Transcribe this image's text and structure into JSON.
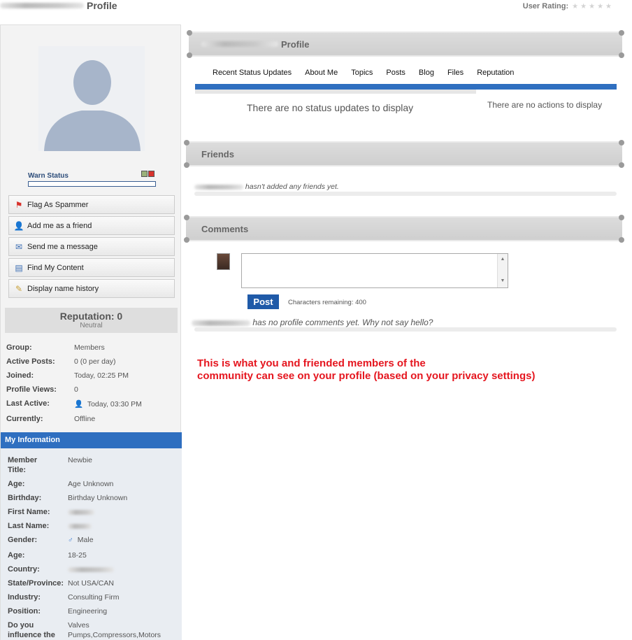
{
  "header": {
    "title": "Profile",
    "user_rating_label": "User Rating:"
  },
  "sidebar": {
    "warn_status": "Warn Status",
    "actions": [
      {
        "label": "Flag As Spammer",
        "icon": "flag-icon"
      },
      {
        "label": "Add me as a friend",
        "icon": "add-friend-icon"
      },
      {
        "label": "Send me a message",
        "icon": "envelope-icon"
      },
      {
        "label": "Find My Content",
        "icon": "document-icon"
      },
      {
        "label": "Display name history",
        "icon": "tag-icon"
      }
    ],
    "reputation": {
      "title": "Reputation: 0",
      "subtitle": "Neutral"
    },
    "stats": [
      {
        "label": "Group:",
        "value": "Members"
      },
      {
        "label": "Active Posts:",
        "value": "0 (0 per day)"
      },
      {
        "label": "Joined:",
        "value": "Today, 02:25 PM"
      },
      {
        "label": "Profile Views:",
        "value": "0"
      },
      {
        "label": "Last Active:",
        "value": "Today, 03:30 PM"
      },
      {
        "label": "Currently:",
        "value": "Offline"
      }
    ],
    "my_info_title": "My Information",
    "my_info": [
      {
        "label": "Member Title:",
        "value": "Newbie"
      },
      {
        "label": "Age:",
        "value": "Age Unknown"
      },
      {
        "label": "Birthday:",
        "value": "Birthday Unknown"
      },
      {
        "label": "First Name:",
        "value": ""
      },
      {
        "label": "Last Name:",
        "value": ""
      },
      {
        "label": "Gender:",
        "value": "Male"
      },
      {
        "label": "Age:",
        "value": "18-25"
      },
      {
        "label": "Country:",
        "value": ""
      },
      {
        "label": "State/Province:",
        "value": "Not USA/CAN"
      },
      {
        "label": "Industry:",
        "value": "Consulting Firm"
      },
      {
        "label": "Position:",
        "value": "Engineering"
      },
      {
        "label": "Do you influence the",
        "value": "Valves Pumps,Compressors,Motors"
      }
    ]
  },
  "profile_panel": {
    "title": "Profile",
    "tabs": [
      "Recent Status Updates",
      "About Me",
      "Topics",
      "Posts",
      "Blog",
      "Files",
      "Reputation"
    ],
    "no_status": "There are no status updates to display",
    "no_actions": "There are no actions to display"
  },
  "friends_panel": {
    "title": "Friends",
    "empty_text": "hasn't added any friends yet."
  },
  "comments_panel": {
    "title": "Comments",
    "post_button": "Post",
    "chars_remaining": "Characters remaining: 400",
    "empty_text": "has no profile comments yet. Why not say hello?"
  },
  "annotation": {
    "line1": "This is what you and friended members of the",
    "line2": "community can see on your profile (based on your privacy settings)"
  },
  "colors": {
    "accent_blue": "#2f6fc0",
    "annotation_red": "#e5161f"
  }
}
